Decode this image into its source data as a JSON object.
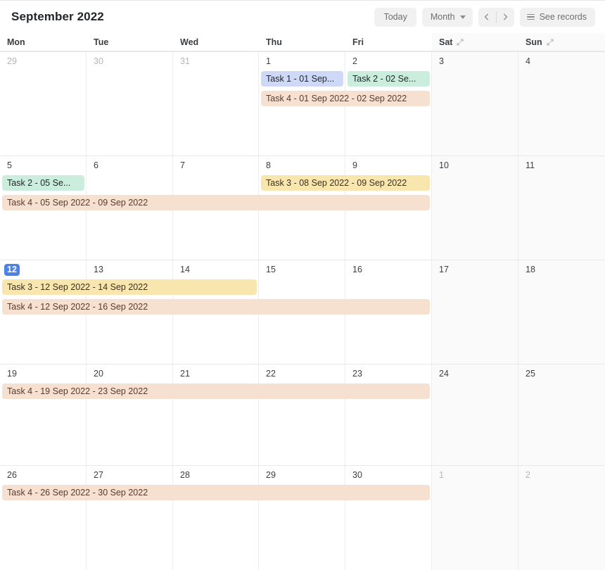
{
  "header": {
    "title": "September 2022",
    "today_label": "Today",
    "view_label": "Month",
    "view_caret_icon": "chevron-down-icon",
    "prev_icon": "chevron-left-icon",
    "next_icon": "chevron-right-icon",
    "records_label": "See records",
    "records_icon": "list-icon"
  },
  "weekdays": [
    {
      "label": "Mon",
      "weekend": false,
      "collapsible": false
    },
    {
      "label": "Tue",
      "weekend": false,
      "collapsible": false
    },
    {
      "label": "Wed",
      "weekend": false,
      "collapsible": false
    },
    {
      "label": "Thu",
      "weekend": false,
      "collapsible": false
    },
    {
      "label": "Fri",
      "weekend": false,
      "collapsible": false
    },
    {
      "label": "Sat",
      "weekend": true,
      "collapsible": true
    },
    {
      "label": "Sun",
      "weekend": true,
      "collapsible": true
    }
  ],
  "weeks": [
    {
      "days": [
        {
          "num": "29",
          "muted": true,
          "today": false
        },
        {
          "num": "30",
          "muted": true,
          "today": false
        },
        {
          "num": "31",
          "muted": true,
          "today": false
        },
        {
          "num": "1",
          "muted": false,
          "today": false
        },
        {
          "num": "2",
          "muted": false,
          "today": false
        },
        {
          "num": "3",
          "muted": false,
          "today": false
        },
        {
          "num": "4",
          "muted": false,
          "today": false
        }
      ],
      "events": [
        {
          "label": "Task 1 - 01 Sep...",
          "color": "blue",
          "start": 3,
          "span": 1,
          "lane": 0
        },
        {
          "label": "Task 2 - 02 Se...",
          "color": "green",
          "start": 4,
          "span": 1,
          "lane": 0
        },
        {
          "label": "Task 4 - 01 Sep 2022 - 02 Sep 2022",
          "color": "peach",
          "start": 3,
          "span": 2,
          "lane": 1
        }
      ]
    },
    {
      "days": [
        {
          "num": "5",
          "muted": false,
          "today": false
        },
        {
          "num": "6",
          "muted": false,
          "today": false
        },
        {
          "num": "7",
          "muted": false,
          "today": false
        },
        {
          "num": "8",
          "muted": false,
          "today": false
        },
        {
          "num": "9",
          "muted": false,
          "today": false
        },
        {
          "num": "10",
          "muted": false,
          "today": false
        },
        {
          "num": "11",
          "muted": false,
          "today": false
        }
      ],
      "events": [
        {
          "label": "Task 2 - 05 Se...",
          "color": "green",
          "start": 0,
          "span": 1,
          "lane": 0
        },
        {
          "label": "Task 3 - 08 Sep 2022 - 09 Sep 2022",
          "color": "yellow",
          "start": 3,
          "span": 2,
          "lane": 0
        },
        {
          "label": "Task 4 - 05 Sep 2022 - 09 Sep 2022",
          "color": "peach",
          "start": 0,
          "span": 5,
          "lane": 1
        }
      ]
    },
    {
      "days": [
        {
          "num": "12",
          "muted": false,
          "today": true
        },
        {
          "num": "13",
          "muted": false,
          "today": false
        },
        {
          "num": "14",
          "muted": false,
          "today": false
        },
        {
          "num": "15",
          "muted": false,
          "today": false
        },
        {
          "num": "16",
          "muted": false,
          "today": false
        },
        {
          "num": "17",
          "muted": false,
          "today": false
        },
        {
          "num": "18",
          "muted": false,
          "today": false
        }
      ],
      "events": [
        {
          "label": "Task 3 - 12 Sep 2022 - 14 Sep 2022",
          "color": "yellow",
          "start": 0,
          "span": 3,
          "lane": 0
        },
        {
          "label": "Task 4 - 12 Sep 2022 - 16 Sep 2022",
          "color": "peach",
          "start": 0,
          "span": 5,
          "lane": 1
        }
      ]
    },
    {
      "days": [
        {
          "num": "19",
          "muted": false,
          "today": false
        },
        {
          "num": "20",
          "muted": false,
          "today": false
        },
        {
          "num": "21",
          "muted": false,
          "today": false
        },
        {
          "num": "22",
          "muted": false,
          "today": false
        },
        {
          "num": "23",
          "muted": false,
          "today": false
        },
        {
          "num": "24",
          "muted": false,
          "today": false
        },
        {
          "num": "25",
          "muted": false,
          "today": false
        }
      ],
      "events": [
        {
          "label": "Task 4 - 19 Sep 2022 - 23 Sep 2022",
          "color": "peach",
          "start": 0,
          "span": 5,
          "lane": 0
        }
      ]
    },
    {
      "days": [
        {
          "num": "26",
          "muted": false,
          "today": false
        },
        {
          "num": "27",
          "muted": false,
          "today": false
        },
        {
          "num": "28",
          "muted": false,
          "today": false
        },
        {
          "num": "29",
          "muted": false,
          "today": false
        },
        {
          "num": "30",
          "muted": false,
          "today": false
        },
        {
          "num": "1",
          "muted": true,
          "today": false
        },
        {
          "num": "2",
          "muted": true,
          "today": false
        }
      ],
      "events": [
        {
          "label": "Task 4 - 26 Sep 2022 - 30 Sep 2022",
          "color": "peach",
          "start": 0,
          "span": 5,
          "lane": 0
        }
      ]
    }
  ],
  "colors": {
    "task1": "#ced8f7",
    "task2": "#caeddd",
    "task3": "#f8e6ae",
    "task4": "#f6e0d0",
    "today_badge": "#4b82e8",
    "weekend_bg": "#fafafa"
  }
}
